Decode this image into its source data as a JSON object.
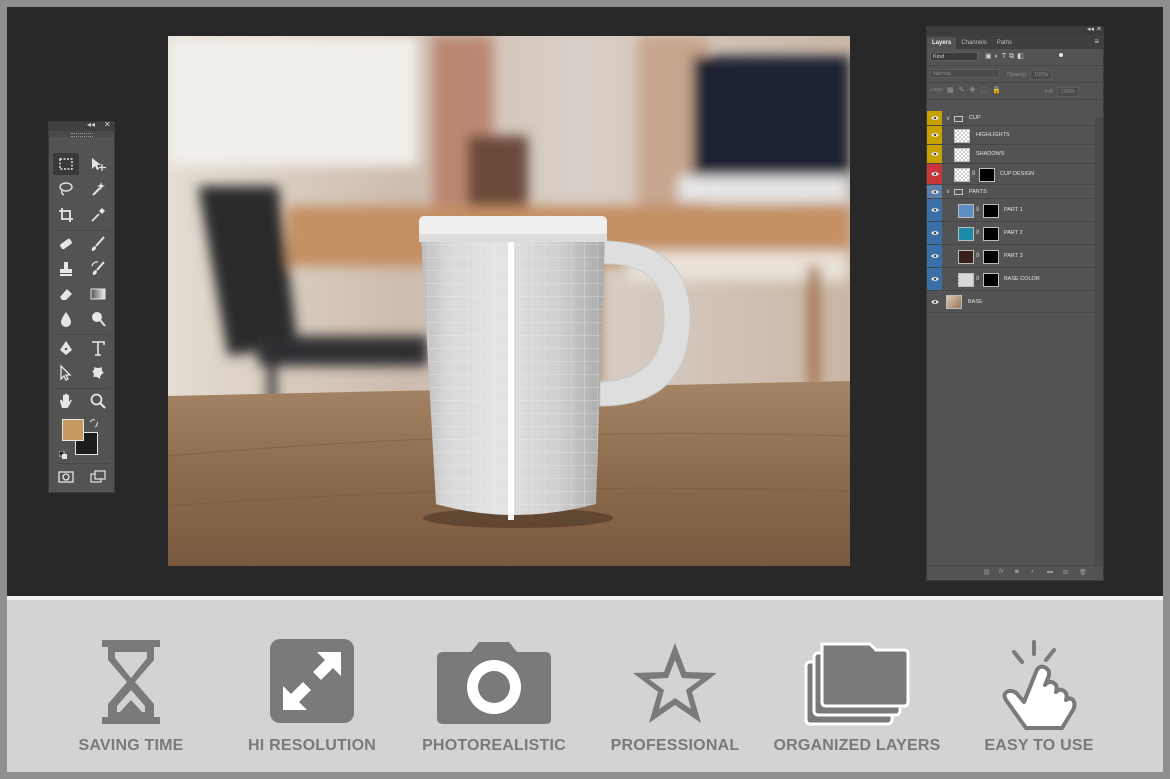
{
  "tools_panel": {
    "collapse_glyph": "◂◂",
    "close_glyph": "✕",
    "foreground_color": "#c49a5e",
    "background_color": "#1d1d1d"
  },
  "layers_panel": {
    "tabs": [
      "Layers",
      "Channels",
      "Paths"
    ],
    "collapse_glyph": "◂◂",
    "close_glyph": "✕",
    "menu_glyph": "≡",
    "filter_kind": "Kind",
    "blend_mode": "Normal",
    "opacity_label": "Opacity:",
    "opacity_value": "100%",
    "lock_label": "Lock:",
    "fill_label": "Fill:",
    "fill_value": "100%",
    "layers": [
      {
        "name": "CUP",
        "type": "group",
        "eye_color": "#c8a000"
      },
      {
        "name": "HIGHLIGHTS",
        "type": "layer",
        "eye_color": "#c8a000"
      },
      {
        "name": "SHADOWS",
        "type": "layer",
        "eye_color": "#c8a000"
      },
      {
        "name": "CUP DESIGN",
        "type": "smart",
        "eye_color": "#c8383a"
      },
      {
        "name": "PARTS",
        "type": "group",
        "eye_color": "#5b7fa8"
      },
      {
        "name": "PART 1",
        "type": "fill",
        "eye_color": "#3b6fa8",
        "swatch": "#5a8fc8"
      },
      {
        "name": "PART 2",
        "type": "fill",
        "eye_color": "#3b6fa8",
        "swatch": "#1c8aa8"
      },
      {
        "name": "PART 3",
        "type": "fill",
        "eye_color": "#3b6fa8",
        "swatch": "#3b1f1a"
      },
      {
        "name": "BASE COLOR",
        "type": "fill",
        "eye_color": "#3b6fa8",
        "swatch": "#d8d8d8"
      },
      {
        "name": "BASE",
        "type": "image",
        "eye_color": "#535353"
      }
    ]
  },
  "features": [
    {
      "label": "SAVING TIME",
      "icon": "hourglass-icon"
    },
    {
      "label": "HI RESOLUTION",
      "icon": "expand-arrows-icon"
    },
    {
      "label": "PHOTOREALISTIC",
      "icon": "camera-icon"
    },
    {
      "label": "PROFESSIONAL",
      "icon": "star-icon"
    },
    {
      "label": "ORGANIZED LAYERS",
      "icon": "layers-stack-icon"
    },
    {
      "label": "EASY TO USE",
      "icon": "tap-hand-icon"
    }
  ],
  "colors": {
    "workspace_bg": "#282828",
    "panel_bg": "#535353",
    "feature_icon": "#7a7a7a",
    "feature_bg": "#d3d3d3"
  }
}
